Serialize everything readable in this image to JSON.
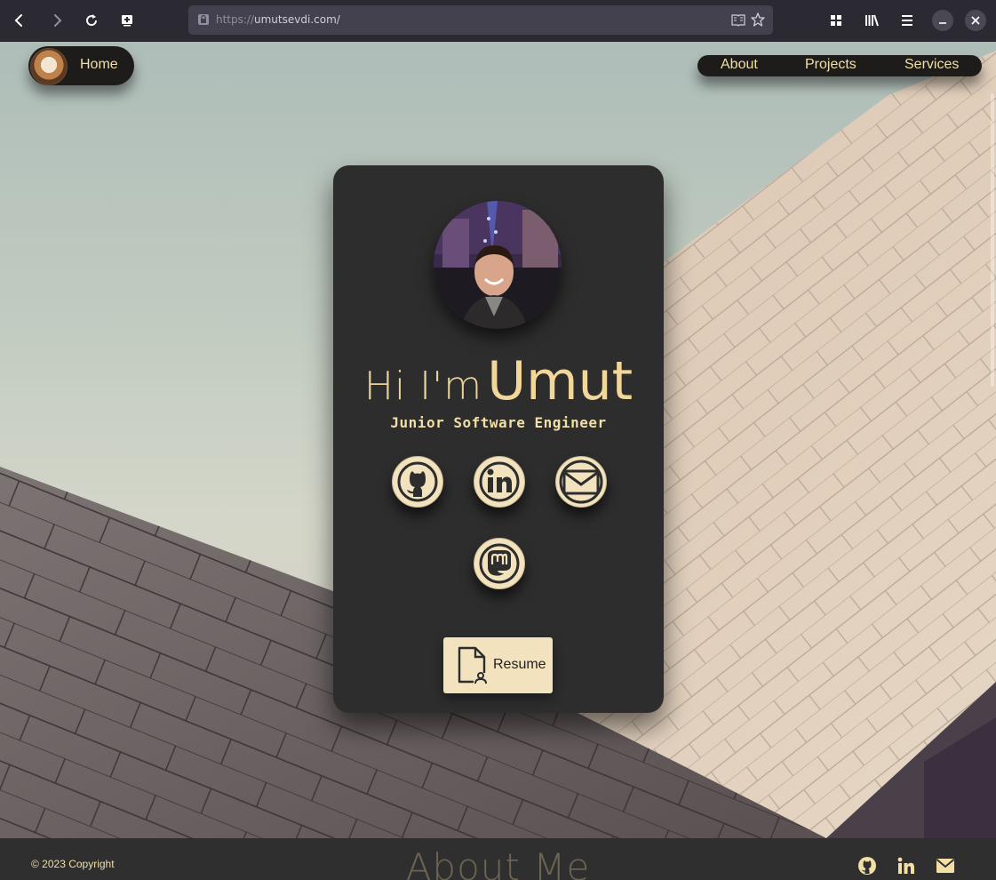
{
  "browser": {
    "url_protocol": "https://",
    "url_host": "umutsevdi.com/",
    "icons": [
      "back-icon",
      "forward-icon",
      "reload-icon",
      "screenshot-icon",
      "lock-icon",
      "reader-view-icon",
      "bookmark-star-icon",
      "grid-icon",
      "library-icon",
      "menu-icon",
      "minimize-icon",
      "close-icon"
    ]
  },
  "nav": {
    "home_label": "Home",
    "links": [
      "About",
      "Projects",
      "Services"
    ]
  },
  "card": {
    "greeting": "Hi I'm",
    "name": "Umut",
    "role": "Junior Software Engineer",
    "social_icons": [
      "github-icon",
      "linkedin-icon",
      "email-icon",
      "mastodon-icon"
    ],
    "resume_label": "Resume"
  },
  "footer": {
    "copyright": "© 2023 Copyright",
    "section_heading": "About Me",
    "icons": [
      "github-icon",
      "linkedin-icon",
      "email-icon"
    ]
  },
  "colors": {
    "accent": "#f2dfa6",
    "card_bg": "#2d2d2d",
    "button_bg": "#f2e2bd"
  }
}
